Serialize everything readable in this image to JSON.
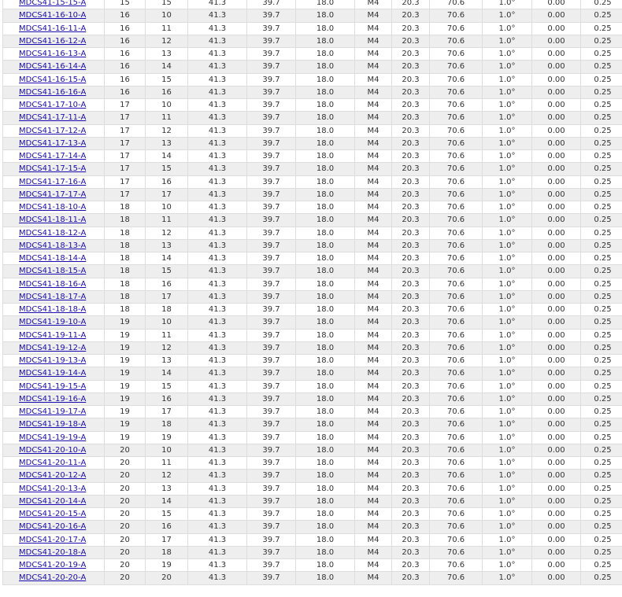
{
  "table": {
    "rows": [
      [
        "MDCS41-15-15-A",
        "15",
        "15",
        "41.3",
        "39.7",
        "18.0",
        "M4",
        "20.3",
        "70.6",
        "1.0°",
        "0.00",
        "0.25"
      ],
      [
        "MDCS41-16-10-A",
        "16",
        "10",
        "41.3",
        "39.7",
        "18.0",
        "M4",
        "20.3",
        "70.6",
        "1.0°",
        "0.00",
        "0.25"
      ],
      [
        "MDCS41-16-11-A",
        "16",
        "11",
        "41.3",
        "39.7",
        "18.0",
        "M4",
        "20.3",
        "70.6",
        "1.0°",
        "0.00",
        "0.25"
      ],
      [
        "MDCS41-16-12-A",
        "16",
        "12",
        "41.3",
        "39.7",
        "18.0",
        "M4",
        "20.3",
        "70.6",
        "1.0°",
        "0.00",
        "0.25"
      ],
      [
        "MDCS41-16-13-A",
        "16",
        "13",
        "41.3",
        "39.7",
        "18.0",
        "M4",
        "20.3",
        "70.6",
        "1.0°",
        "0.00",
        "0.25"
      ],
      [
        "MDCS41-16-14-A",
        "16",
        "14",
        "41.3",
        "39.7",
        "18.0",
        "M4",
        "20.3",
        "70.6",
        "1.0°",
        "0.00",
        "0.25"
      ],
      [
        "MDCS41-16-15-A",
        "16",
        "15",
        "41.3",
        "39.7",
        "18.0",
        "M4",
        "20.3",
        "70.6",
        "1.0°",
        "0.00",
        "0.25"
      ],
      [
        "MDCS41-16-16-A",
        "16",
        "16",
        "41.3",
        "39.7",
        "18.0",
        "M4",
        "20.3",
        "70.6",
        "1.0°",
        "0.00",
        "0.25"
      ],
      [
        "MDCS41-17-10-A",
        "17",
        "10",
        "41.3",
        "39.7",
        "18.0",
        "M4",
        "20.3",
        "70.6",
        "1.0°",
        "0.00",
        "0.25"
      ],
      [
        "MDCS41-17-11-A",
        "17",
        "11",
        "41.3",
        "39.7",
        "18.0",
        "M4",
        "20.3",
        "70.6",
        "1.0°",
        "0.00",
        "0.25"
      ],
      [
        "MDCS41-17-12-A",
        "17",
        "12",
        "41.3",
        "39.7",
        "18.0",
        "M4",
        "20.3",
        "70.6",
        "1.0°",
        "0.00",
        "0.25"
      ],
      [
        "MDCS41-17-13-A",
        "17",
        "13",
        "41.3",
        "39.7",
        "18.0",
        "M4",
        "20.3",
        "70.6",
        "1.0°",
        "0.00",
        "0.25"
      ],
      [
        "MDCS41-17-14-A",
        "17",
        "14",
        "41.3",
        "39.7",
        "18.0",
        "M4",
        "20.3",
        "70.6",
        "1.0°",
        "0.00",
        "0.25"
      ],
      [
        "MDCS41-17-15-A",
        "17",
        "15",
        "41.3",
        "39.7",
        "18.0",
        "M4",
        "20.3",
        "70.6",
        "1.0°",
        "0.00",
        "0.25"
      ],
      [
        "MDCS41-17-16-A",
        "17",
        "16",
        "41.3",
        "39.7",
        "18.0",
        "M4",
        "20.3",
        "70.6",
        "1.0°",
        "0.00",
        "0.25"
      ],
      [
        "MDCS41-17-17-A",
        "17",
        "17",
        "41.3",
        "39.7",
        "18.0",
        "M4",
        "20.3",
        "70.6",
        "1.0°",
        "0.00",
        "0.25"
      ],
      [
        "MDCS41-18-10-A",
        "18",
        "10",
        "41.3",
        "39.7",
        "18.0",
        "M4",
        "20.3",
        "70.6",
        "1.0°",
        "0.00",
        "0.25"
      ],
      [
        "MDCS41-18-11-A",
        "18",
        "11",
        "41.3",
        "39.7",
        "18.0",
        "M4",
        "20.3",
        "70.6",
        "1.0°",
        "0.00",
        "0.25"
      ],
      [
        "MDCS41-18-12-A",
        "18",
        "12",
        "41.3",
        "39.7",
        "18.0",
        "M4",
        "20.3",
        "70.6",
        "1.0°",
        "0.00",
        "0.25"
      ],
      [
        "MDCS41-18-13-A",
        "18",
        "13",
        "41.3",
        "39.7",
        "18.0",
        "M4",
        "20.3",
        "70.6",
        "1.0°",
        "0.00",
        "0.25"
      ],
      [
        "MDCS41-18-14-A",
        "18",
        "14",
        "41.3",
        "39.7",
        "18.0",
        "M4",
        "20.3",
        "70.6",
        "1.0°",
        "0.00",
        "0.25"
      ],
      [
        "MDCS41-18-15-A",
        "18",
        "15",
        "41.3",
        "39.7",
        "18.0",
        "M4",
        "20.3",
        "70.6",
        "1.0°",
        "0.00",
        "0.25"
      ],
      [
        "MDCS41-18-16-A",
        "18",
        "16",
        "41.3",
        "39.7",
        "18.0",
        "M4",
        "20.3",
        "70.6",
        "1.0°",
        "0.00",
        "0.25"
      ],
      [
        "MDCS41-18-17-A",
        "18",
        "17",
        "41.3",
        "39.7",
        "18.0",
        "M4",
        "20.3",
        "70.6",
        "1.0°",
        "0.00",
        "0.25"
      ],
      [
        "MDCS41-18-18-A",
        "18",
        "18",
        "41.3",
        "39.7",
        "18.0",
        "M4",
        "20.3",
        "70.6",
        "1.0°",
        "0.00",
        "0.25"
      ],
      [
        "MDCS41-19-10-A",
        "19",
        "10",
        "41.3",
        "39.7",
        "18.0",
        "M4",
        "20.3",
        "70.6",
        "1.0°",
        "0.00",
        "0.25"
      ],
      [
        "MDCS41-19-11-A",
        "19",
        "11",
        "41.3",
        "39.7",
        "18.0",
        "M4",
        "20.3",
        "70.6",
        "1.0°",
        "0.00",
        "0.25"
      ],
      [
        "MDCS41-19-12-A",
        "19",
        "12",
        "41.3",
        "39.7",
        "18.0",
        "M4",
        "20.3",
        "70.6",
        "1.0°",
        "0.00",
        "0.25"
      ],
      [
        "MDCS41-19-13-A",
        "19",
        "13",
        "41.3",
        "39.7",
        "18.0",
        "M4",
        "20.3",
        "70.6",
        "1.0°",
        "0.00",
        "0.25"
      ],
      [
        "MDCS41-19-14-A",
        "19",
        "14",
        "41.3",
        "39.7",
        "18.0",
        "M4",
        "20.3",
        "70.6",
        "1.0°",
        "0.00",
        "0.25"
      ],
      [
        "MDCS41-19-15-A",
        "19",
        "15",
        "41.3",
        "39.7",
        "18.0",
        "M4",
        "20.3",
        "70.6",
        "1.0°",
        "0.00",
        "0.25"
      ],
      [
        "MDCS41-19-16-A",
        "19",
        "16",
        "41.3",
        "39.7",
        "18.0",
        "M4",
        "20.3",
        "70.6",
        "1.0°",
        "0.00",
        "0.25"
      ],
      [
        "MDCS41-19-17-A",
        "19",
        "17",
        "41.3",
        "39.7",
        "18.0",
        "M4",
        "20.3",
        "70.6",
        "1.0°",
        "0.00",
        "0.25"
      ],
      [
        "MDCS41-19-18-A",
        "19",
        "18",
        "41.3",
        "39.7",
        "18.0",
        "M4",
        "20.3",
        "70.6",
        "1.0°",
        "0.00",
        "0.25"
      ],
      [
        "MDCS41-19-19-A",
        "19",
        "19",
        "41.3",
        "39.7",
        "18.0",
        "M4",
        "20.3",
        "70.6",
        "1.0°",
        "0.00",
        "0.25"
      ],
      [
        "MDCS41-20-10-A",
        "20",
        "10",
        "41.3",
        "39.7",
        "18.0",
        "M4",
        "20.3",
        "70.6",
        "1.0°",
        "0.00",
        "0.25"
      ],
      [
        "MDCS41-20-11-A",
        "20",
        "11",
        "41.3",
        "39.7",
        "18.0",
        "M4",
        "20.3",
        "70.6",
        "1.0°",
        "0.00",
        "0.25"
      ],
      [
        "MDCS41-20-12-A",
        "20",
        "12",
        "41.3",
        "39.7",
        "18.0",
        "M4",
        "20.3",
        "70.6",
        "1.0°",
        "0.00",
        "0.25"
      ],
      [
        "MDCS41-20-13-A",
        "20",
        "13",
        "41.3",
        "39.7",
        "18.0",
        "M4",
        "20.3",
        "70.6",
        "1.0°",
        "0.00",
        "0.25"
      ],
      [
        "MDCS41-20-14-A",
        "20",
        "14",
        "41.3",
        "39.7",
        "18.0",
        "M4",
        "20.3",
        "70.6",
        "1.0°",
        "0.00",
        "0.25"
      ],
      [
        "MDCS41-20-15-A",
        "20",
        "15",
        "41.3",
        "39.7",
        "18.0",
        "M4",
        "20.3",
        "70.6",
        "1.0°",
        "0.00",
        "0.25"
      ],
      [
        "MDCS41-20-16-A",
        "20",
        "16",
        "41.3",
        "39.7",
        "18.0",
        "M4",
        "20.3",
        "70.6",
        "1.0°",
        "0.00",
        "0.25"
      ],
      [
        "MDCS41-20-17-A",
        "20",
        "17",
        "41.3",
        "39.7",
        "18.0",
        "M4",
        "20.3",
        "70.6",
        "1.0°",
        "0.00",
        "0.25"
      ],
      [
        "MDCS41-20-18-A",
        "20",
        "18",
        "41.3",
        "39.7",
        "18.0",
        "M4",
        "20.3",
        "70.6",
        "1.0°",
        "0.00",
        "0.25"
      ],
      [
        "MDCS41-20-19-A",
        "20",
        "19",
        "41.3",
        "39.7",
        "18.0",
        "M4",
        "20.3",
        "70.6",
        "1.0°",
        "0.00",
        "0.25"
      ],
      [
        "MDCS41-20-20-A",
        "20",
        "20",
        "41.3",
        "39.7",
        "18.0",
        "M4",
        "20.3",
        "70.6",
        "1.0°",
        "0.00",
        "0.25"
      ]
    ]
  },
  "colors": {
    "link": "#1a0dab",
    "row_alt": "#eeeeee",
    "row": "#ffffff",
    "border": "#dddddd",
    "text": "#333333"
  }
}
